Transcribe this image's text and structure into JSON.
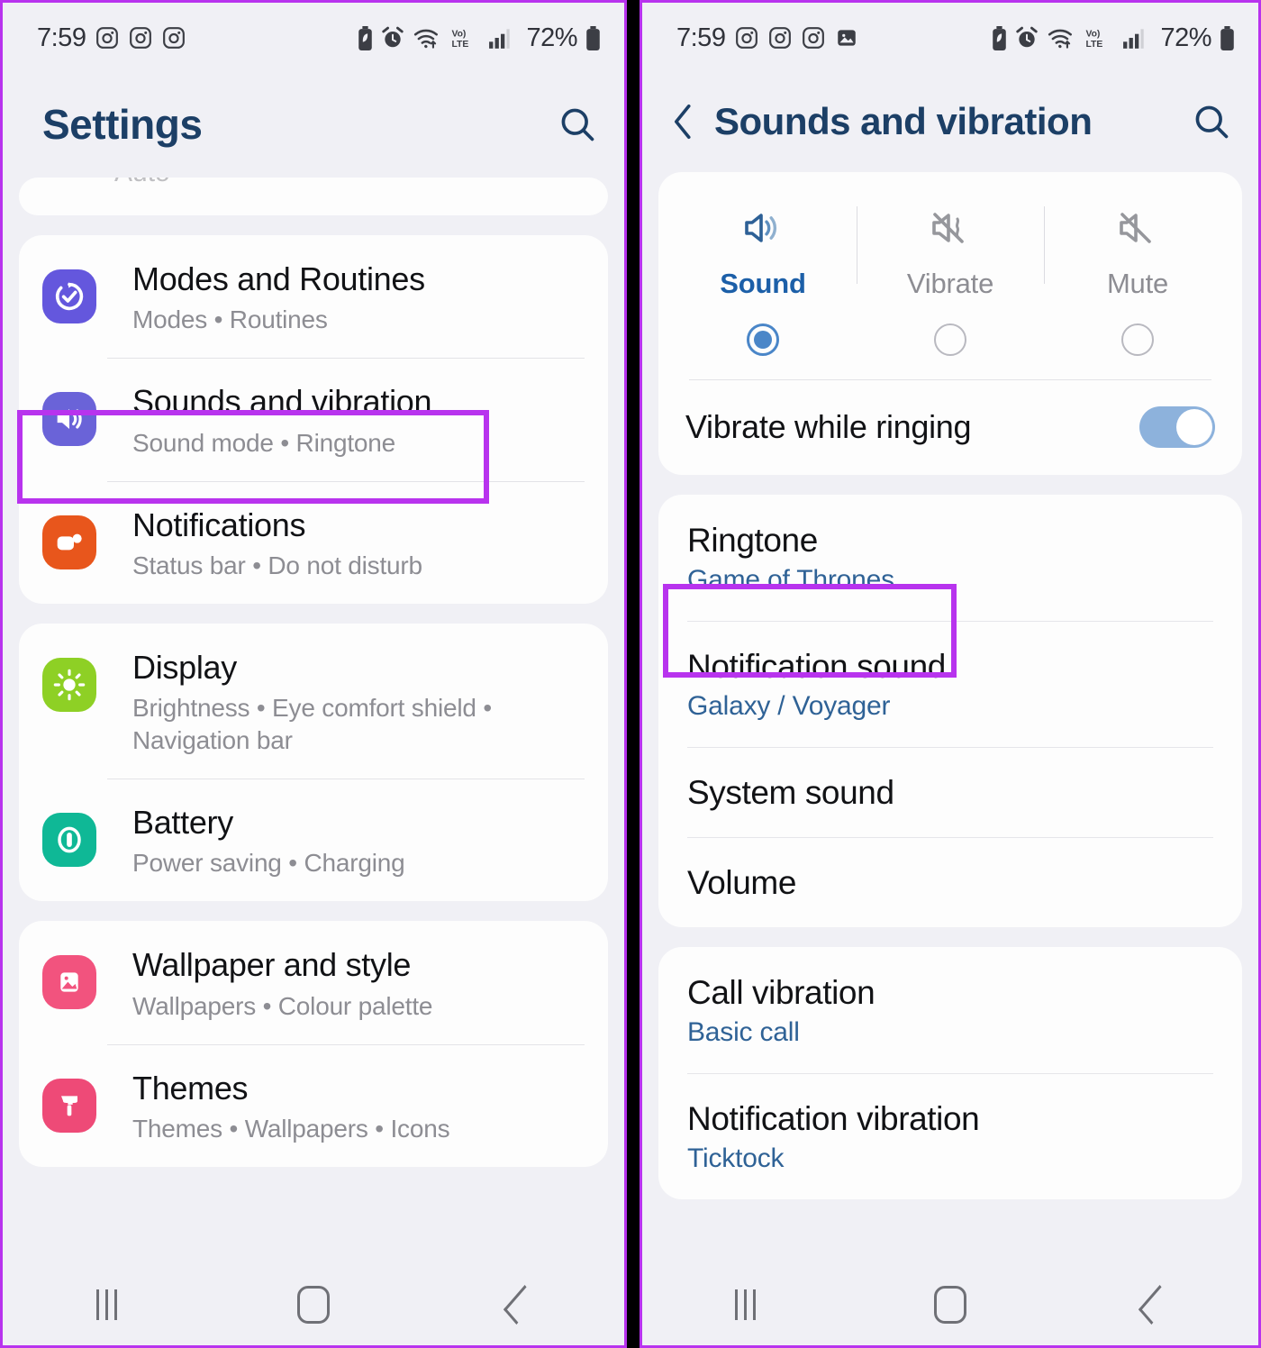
{
  "left": {
    "status": {
      "time": "7:59",
      "battery_percent": "72%",
      "icons": [
        "instagram-icon",
        "instagram-icon",
        "instagram-icon"
      ],
      "right_icons": [
        "battery-saver-icon",
        "alarm-icon",
        "wifi-icon",
        "volte-icon",
        "signal-icon",
        "battery-icon"
      ]
    },
    "header": {
      "title": "Settings",
      "search": "search-icon"
    },
    "partial_top_item": "Auto",
    "groups": [
      {
        "items": [
          {
            "title": "Modes and Routines",
            "subtitle": "Modes  •  Routines",
            "icon": "modes-routines-icon",
            "icon_color": "#6457dd",
            "highlighted": false
          },
          {
            "title": "Sounds and vibration",
            "subtitle": "Sound mode  •  Ringtone",
            "icon": "sound-vibration-icon",
            "icon_color": "#6a63d8",
            "highlighted": true
          },
          {
            "title": "Notifications",
            "subtitle": "Status bar  •  Do not disturb",
            "icon": "notifications-icon",
            "icon_color": "#e8561c",
            "highlighted": false
          }
        ]
      },
      {
        "items": [
          {
            "title": "Display",
            "subtitle": "Brightness  •  Eye comfort shield  •  Navigation bar",
            "icon": "display-icon",
            "icon_color": "#8ed025",
            "highlighted": false
          },
          {
            "title": "Battery",
            "subtitle": "Power saving  •  Charging",
            "icon": "battery-settings-icon",
            "icon_color": "#0fb896",
            "highlighted": false
          }
        ]
      },
      {
        "items": [
          {
            "title": "Wallpaper and style",
            "subtitle": "Wallpapers  •  Colour palette",
            "icon": "wallpaper-icon",
            "icon_color": "#f2537e",
            "highlighted": false
          },
          {
            "title": "Themes",
            "subtitle": "Themes  •  Wallpapers  •  Icons",
            "icon": "themes-icon",
            "icon_color": "#ee4a77",
            "highlighted": false
          }
        ]
      }
    ],
    "navbar": {
      "recents": "recents-icon",
      "home": "home-icon",
      "back": "back-icon"
    }
  },
  "right": {
    "status": {
      "time": "7:59",
      "battery_percent": "72%",
      "icons": [
        "instagram-icon",
        "instagram-icon",
        "instagram-icon",
        "screenshot-icon"
      ]
    },
    "header": {
      "back": "back-arrow-icon",
      "title": "Sounds and vibration",
      "search": "search-icon"
    },
    "sound_mode": {
      "options": [
        {
          "label": "Sound",
          "icon": "volume-on-icon",
          "selected": true
        },
        {
          "label": "Vibrate",
          "icon": "vibrate-icon",
          "selected": false
        },
        {
          "label": "Mute",
          "icon": "volume-mute-icon",
          "selected": false
        }
      ]
    },
    "vibrate_while_ringing": {
      "label": "Vibrate while ringing",
      "enabled": true
    },
    "sound_items": [
      {
        "title": "Ringtone",
        "subtitle": "Game of Thrones",
        "highlighted": true
      },
      {
        "title": "Notification sound",
        "subtitle": "Galaxy / Voyager",
        "highlighted": false
      },
      {
        "title": "System sound",
        "subtitle": "",
        "highlighted": false
      },
      {
        "title": "Volume",
        "subtitle": "",
        "highlighted": false
      }
    ],
    "vibration_items": [
      {
        "title": "Call vibration",
        "subtitle": "Basic call"
      },
      {
        "title": "Notification vibration",
        "subtitle": "Ticktock"
      }
    ],
    "navbar": {
      "recents": "recents-icon",
      "home": "home-icon",
      "back": "back-icon"
    }
  },
  "colors": {
    "highlight": "#b833ee",
    "header_text": "#1c3f66",
    "accent_blue": "#2f6296",
    "switch_on": "#8db2dc",
    "background": "#f0f0f5",
    "card": "#fdfdfd"
  }
}
